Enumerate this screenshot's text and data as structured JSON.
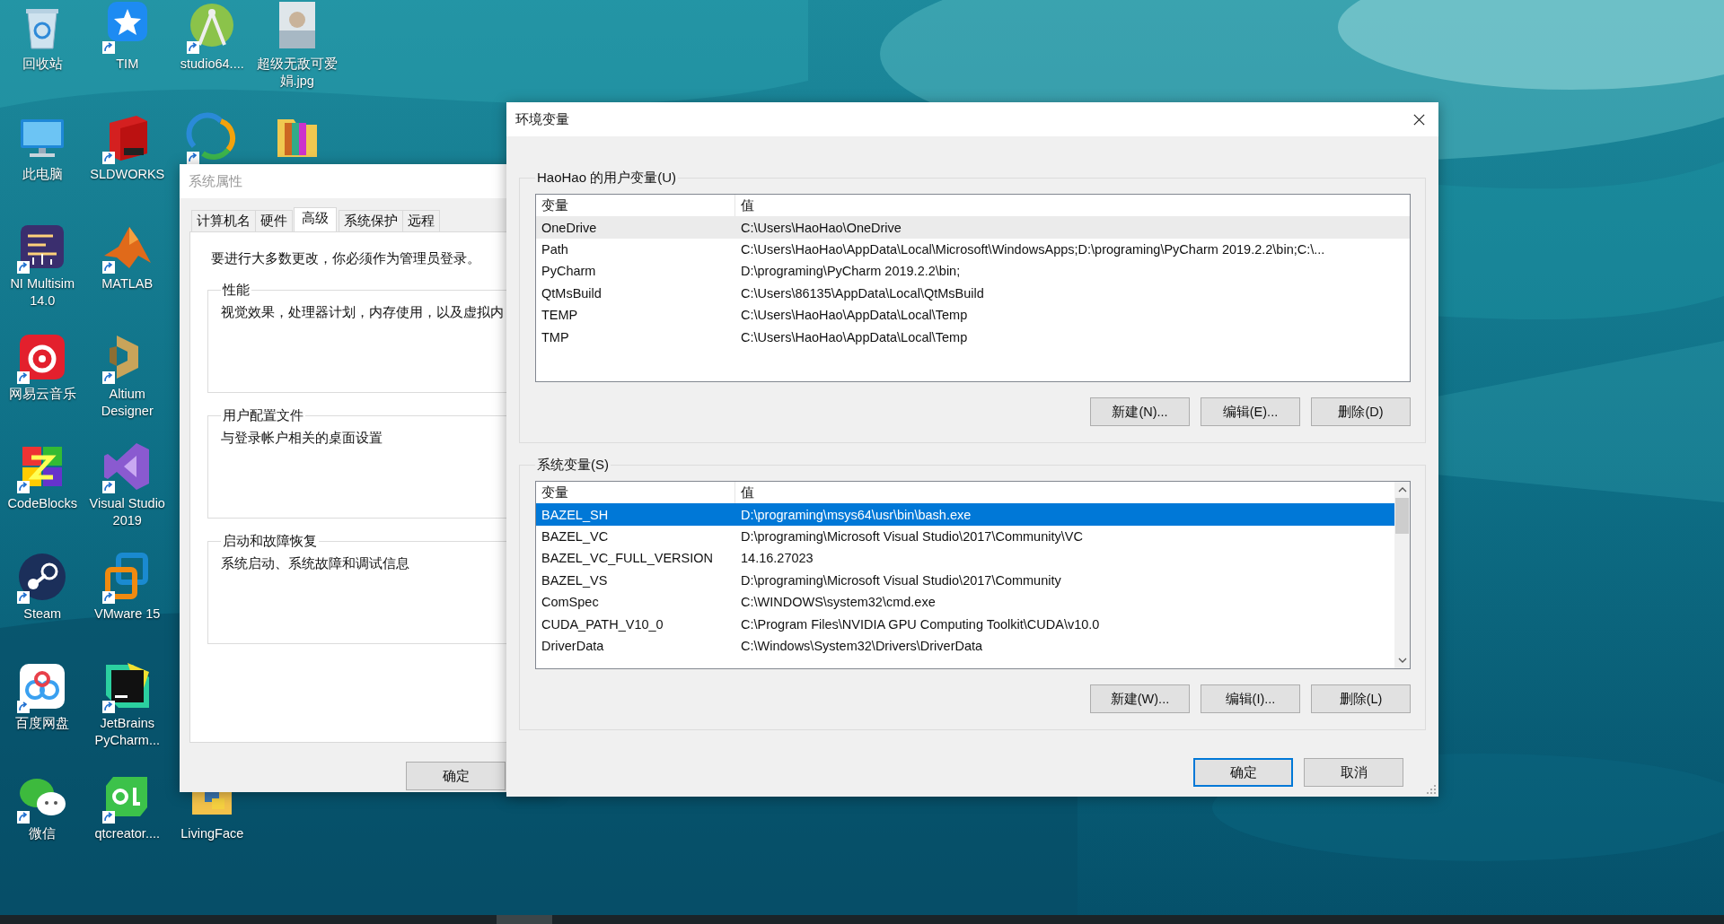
{
  "desktop": {
    "columns": [
      [
        {
          "label": "回收站",
          "shortcut": false
        },
        {
          "label": "此电脑",
          "shortcut": false
        },
        {
          "label": "NI Multisim 14.0",
          "shortcut": true
        },
        {
          "label": "网易云音乐",
          "shortcut": true
        },
        {
          "label": "CodeBlocks",
          "shortcut": true
        },
        {
          "label": "Steam",
          "shortcut": true
        },
        {
          "label": "百度网盘",
          "shortcut": true
        },
        {
          "label": "微信",
          "shortcut": true
        }
      ],
      [
        {
          "label": "TIM",
          "shortcut": true
        },
        {
          "label": "SLDWORKS",
          "shortcut": true
        },
        {
          "label": "MATLAB",
          "shortcut": true
        },
        {
          "label": "Altium Designer",
          "shortcut": true
        },
        {
          "label": "Visual Studio 2019",
          "shortcut": true
        },
        {
          "label": "VMware 15",
          "shortcut": true
        },
        {
          "label": "JetBrains PyCharm...",
          "shortcut": true
        },
        {
          "label": "qtcreator....",
          "shortcut": true
        }
      ],
      [
        {
          "label": "studio64....",
          "shortcut": true
        },
        {
          "shortcut": true
        },
        {
          "label": "LivingFace",
          "shortcut": false
        }
      ],
      [
        {
          "label": "超级无敌可爱娟.jpg",
          "shortcut": false
        },
        {
          "shortcut": false
        }
      ]
    ]
  },
  "system_properties": {
    "title": "系统属性",
    "active": false,
    "tabs": [
      {
        "label": "计算机名",
        "selected": false
      },
      {
        "label": "硬件",
        "selected": false
      },
      {
        "label": "高级",
        "selected": true
      },
      {
        "label": "系统保护",
        "selected": false
      },
      {
        "label": "远程",
        "selected": false
      }
    ],
    "notice": "要进行大多数更改，你必须作为管理员登录。",
    "groups": [
      {
        "title": "性能",
        "text": "视觉效果，处理器计划，内存使用，以及虚拟内"
      },
      {
        "title": "用户配置文件",
        "text": "与登录帐户相关的桌面设置"
      },
      {
        "title": "启动和故障恢复",
        "text": "系统启动、系统故障和调试信息"
      }
    ],
    "buttons": [
      {
        "label": "确定",
        "default": false
      }
    ]
  },
  "environment_variables": {
    "title": "环境变量",
    "active": true,
    "sections": [
      {
        "title": "HaoHao 的用户变量(U)",
        "focused": false,
        "scrollbar": false,
        "columns": [
          "变量",
          "值"
        ],
        "rows": [
          {
            "name": "OneDrive",
            "value": "C:\\Users\\HaoHao\\OneDrive",
            "selected": true
          },
          {
            "name": "Path",
            "value": "C:\\Users\\HaoHao\\AppData\\Local\\Microsoft\\WindowsApps;D:\\programing\\PyCharm 2019.2.2\\bin;C:\\...",
            "selected": false
          },
          {
            "name": "PyCharm",
            "value": "D:\\programing\\PyCharm 2019.2.2\\bin;",
            "selected": false
          },
          {
            "name": "QtMsBuild",
            "value": "C:\\Users\\86135\\AppData\\Local\\QtMsBuild",
            "selected": false
          },
          {
            "name": "TEMP",
            "value": "C:\\Users\\HaoHao\\AppData\\Local\\Temp",
            "selected": false
          },
          {
            "name": "TMP",
            "value": "C:\\Users\\HaoHao\\AppData\\Local\\Temp",
            "selected": false
          }
        ],
        "buttons": [
          "新建(N)...",
          "编辑(E)...",
          "删除(D)"
        ]
      },
      {
        "title": "系统变量(S)",
        "focused": true,
        "scrollbar": true,
        "columns": [
          "变量",
          "值"
        ],
        "rows": [
          {
            "name": "BAZEL_SH",
            "value": "D:\\programing\\msys64\\usr\\bin\\bash.exe",
            "selected": true
          },
          {
            "name": "BAZEL_VC",
            "value": "D:\\programing\\Microsoft Visual Studio\\2017\\Community\\VC",
            "selected": false
          },
          {
            "name": "BAZEL_VC_FULL_VERSION",
            "value": "14.16.27023",
            "selected": false
          },
          {
            "name": "BAZEL_VS",
            "value": "D:\\programing\\Microsoft Visual Studio\\2017\\Community",
            "selected": false
          },
          {
            "name": "ComSpec",
            "value": "C:\\WINDOWS\\system32\\cmd.exe",
            "selected": false
          },
          {
            "name": "CUDA_PATH_V10_0",
            "value": "C:\\Program Files\\NVIDIA GPU Computing Toolkit\\CUDA\\v10.0",
            "selected": false
          },
          {
            "name": "DriverData",
            "value": "C:\\Windows\\System32\\Drivers\\DriverData",
            "selected": false
          }
        ],
        "buttons": [
          "新建(W)...",
          "编辑(I)...",
          "删除(L)"
        ]
      }
    ],
    "buttons": [
      {
        "label": "确定",
        "default": true
      },
      {
        "label": "取消",
        "default": false
      }
    ]
  }
}
